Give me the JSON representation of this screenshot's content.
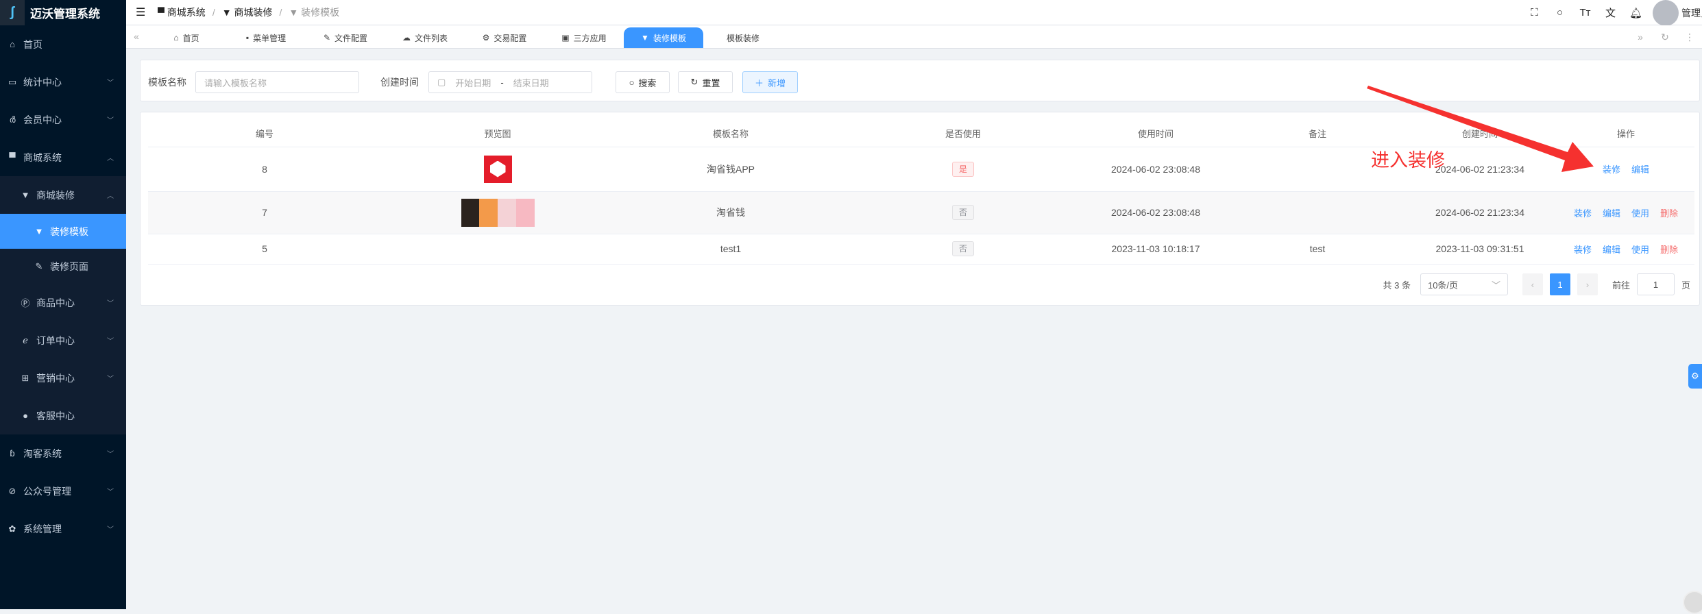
{
  "app": {
    "title": "迈沃管理系统",
    "logo_icon": "swirl-logo"
  },
  "sidebar": {
    "items": [
      {
        "label": "首页",
        "icon": "home-icon"
      },
      {
        "label": "统计中心",
        "icon": "chart-icon"
      },
      {
        "label": "会员中心",
        "icon": "bicycle-icon"
      },
      {
        "label": "商城系统",
        "icon": "shop-icon",
        "expanded": true
      },
      {
        "label": "商城装修",
        "icon": "brush-icon",
        "expanded": true
      },
      {
        "label": "装修模板",
        "icon": "brush-icon",
        "active": true
      },
      {
        "label": "装修页面",
        "icon": "edit-icon"
      },
      {
        "label": "商品中心",
        "icon": "p-circle-icon"
      },
      {
        "label": "订单中心",
        "icon": "order-icon"
      },
      {
        "label": "营销中心",
        "icon": "gift-icon"
      },
      {
        "label": "客服中心",
        "icon": "user-icon"
      },
      {
        "label": "淘客系统",
        "icon": "feed-icon"
      },
      {
        "label": "公众号管理",
        "icon": "compass-icon"
      },
      {
        "label": "系统管理",
        "icon": "gear-icon"
      }
    ]
  },
  "header": {
    "breadcrumb": [
      "商城系统",
      "商城装修",
      "装修模板"
    ],
    "user": "管理员"
  },
  "tabs": [
    "首页",
    "菜单管理",
    "文件配置",
    "文件列表",
    "交易配置",
    "三方应用",
    "装修模板",
    "模板装修"
  ],
  "active_tab": "装修模板",
  "search": {
    "name_label": "模板名称",
    "name_placeholder": "请输入模板名称",
    "time_label": "创建时间",
    "start_placeholder": "开始日期",
    "range_sep": "-",
    "end_placeholder": "结束日期",
    "search_btn": "搜索",
    "reset_btn": "重置",
    "add_btn": "新增"
  },
  "table": {
    "columns": [
      "编号",
      "预览图",
      "模板名称",
      "是否使用",
      "使用时间",
      "备注",
      "创建时间",
      "操作"
    ],
    "rows": [
      {
        "id": "8",
        "name": "淘省钱APP",
        "used": "是",
        "used_time": "2024-06-02 23:08:48",
        "remark": "",
        "created": "2024-06-02 21:23:34",
        "actions": [
          "装修",
          "编辑"
        ]
      },
      {
        "id": "7",
        "name": "淘省钱",
        "used": "否",
        "used_time": "2024-06-02 23:08:48",
        "remark": "",
        "created": "2024-06-02 21:23:34",
        "actions": [
          "装修",
          "编辑",
          "使用",
          "删除"
        ]
      },
      {
        "id": "5",
        "name": "test1",
        "used": "否",
        "used_time": "2023-11-03 10:18:17",
        "remark": "test",
        "created": "2023-11-03 09:31:51",
        "actions": [
          "装修",
          "编辑",
          "使用",
          "删除"
        ]
      }
    ]
  },
  "pagination": {
    "total": "共 3 条",
    "page_size": "10条/页",
    "current": "1",
    "goto_label": "前往",
    "goto_value": "1",
    "page_suffix": "页"
  },
  "annotation": {
    "text": "进入装修",
    "color": "#f5312f"
  },
  "colors": {
    "primary": "#3a96ff",
    "sidebar": "#001528",
    "danger": "#f56c6c"
  }
}
